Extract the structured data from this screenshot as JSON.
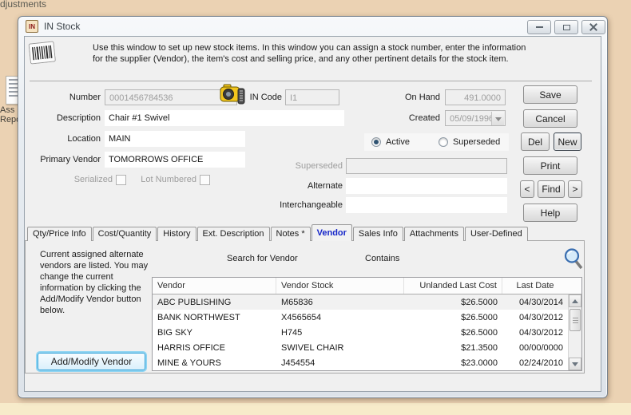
{
  "colors": {
    "desktop": "#ebd2b3",
    "active_tab_text": "#1626c9",
    "focus_glow": "#38a3d8"
  },
  "background": {
    "top_text": "djustments",
    "icon_caption_line1": "Ass",
    "icon_caption_line2": "Repo"
  },
  "window": {
    "title": "IN Stock",
    "icon_text": "IN"
  },
  "intro": {
    "text": "Use this window to set up new stock items. In this window you can assign a stock number, enter the information for the supplier (Vendor), the item's cost and selling price, and any other pertinent details for the stock item."
  },
  "form": {
    "number": {
      "label": "Number",
      "value": "0001456784536"
    },
    "in_code": {
      "label": "IN Code",
      "value": "I1"
    },
    "on_hand": {
      "label": "On Hand",
      "value": "491.0000"
    },
    "description": {
      "label": "Description",
      "value": "Chair #1 Swivel"
    },
    "created": {
      "label": "Created",
      "value": "05/09/1996"
    },
    "location": {
      "label": "Location",
      "value": "MAIN"
    },
    "primary_vendor": {
      "label": "Primary Vendor",
      "value": "TOMORROWS OFFICE"
    },
    "status": {
      "active_label": "Active",
      "superseded_label": "Superseded",
      "selected": "Active"
    },
    "superseded_field": {
      "label": "Superseded",
      "value": ""
    },
    "serialized": {
      "label": "Serialized",
      "checked": false
    },
    "lot_numbered": {
      "label": "Lot Numbered",
      "checked": false
    },
    "alternate": {
      "label": "Alternate",
      "value": ""
    },
    "interchangeable": {
      "label": "Interchangeable",
      "value": ""
    }
  },
  "buttons": {
    "save": "Save",
    "cancel": "Cancel",
    "del": "Del",
    "new": "New",
    "print": "Print",
    "find_prev": "<",
    "find": "Find",
    "find_next": ">",
    "help": "Help"
  },
  "tabs": {
    "items": [
      {
        "label": "Qty/Price Info",
        "active": false
      },
      {
        "label": "Cost/Quantity",
        "active": false
      },
      {
        "label": "History",
        "active": false
      },
      {
        "label": "Ext. Description",
        "active": false
      },
      {
        "label": "Notes *",
        "active": false
      },
      {
        "label": "Vendor",
        "active": true
      },
      {
        "label": "Sales Info",
        "active": false
      },
      {
        "label": "Attachments",
        "active": false
      },
      {
        "label": "User-Defined",
        "active": false
      }
    ]
  },
  "vendor_tab": {
    "instruction": "Current assigned alternate vendors are listed. You may change the current information by clicking the Add/Modify Vendor button below.",
    "add_modify_button": "Add/Modify Vendor",
    "search_label": "Search for Vendor",
    "contains_label": "Contains",
    "selected_row_index": 0,
    "table": {
      "columns": [
        "Vendor",
        "Vendor Stock",
        "Unlanded Last Cost",
        "Last Date"
      ],
      "rows": [
        [
          "ABC PUBLISHING",
          "M65836",
          "$26.5000",
          "04/30/2014"
        ],
        [
          "BANK NORTHWEST",
          "X4565654",
          "$26.5000",
          "04/30/2012"
        ],
        [
          "BIG SKY",
          "H745",
          "$26.5000",
          "04/30/2012"
        ],
        [
          "HARRIS OFFICE",
          "SWIVEL CHAIR",
          "$21.3500",
          "00/00/0000"
        ],
        [
          "MINE & YOURS",
          "J454554",
          "$23.0000",
          "02/24/2010"
        ]
      ]
    }
  }
}
